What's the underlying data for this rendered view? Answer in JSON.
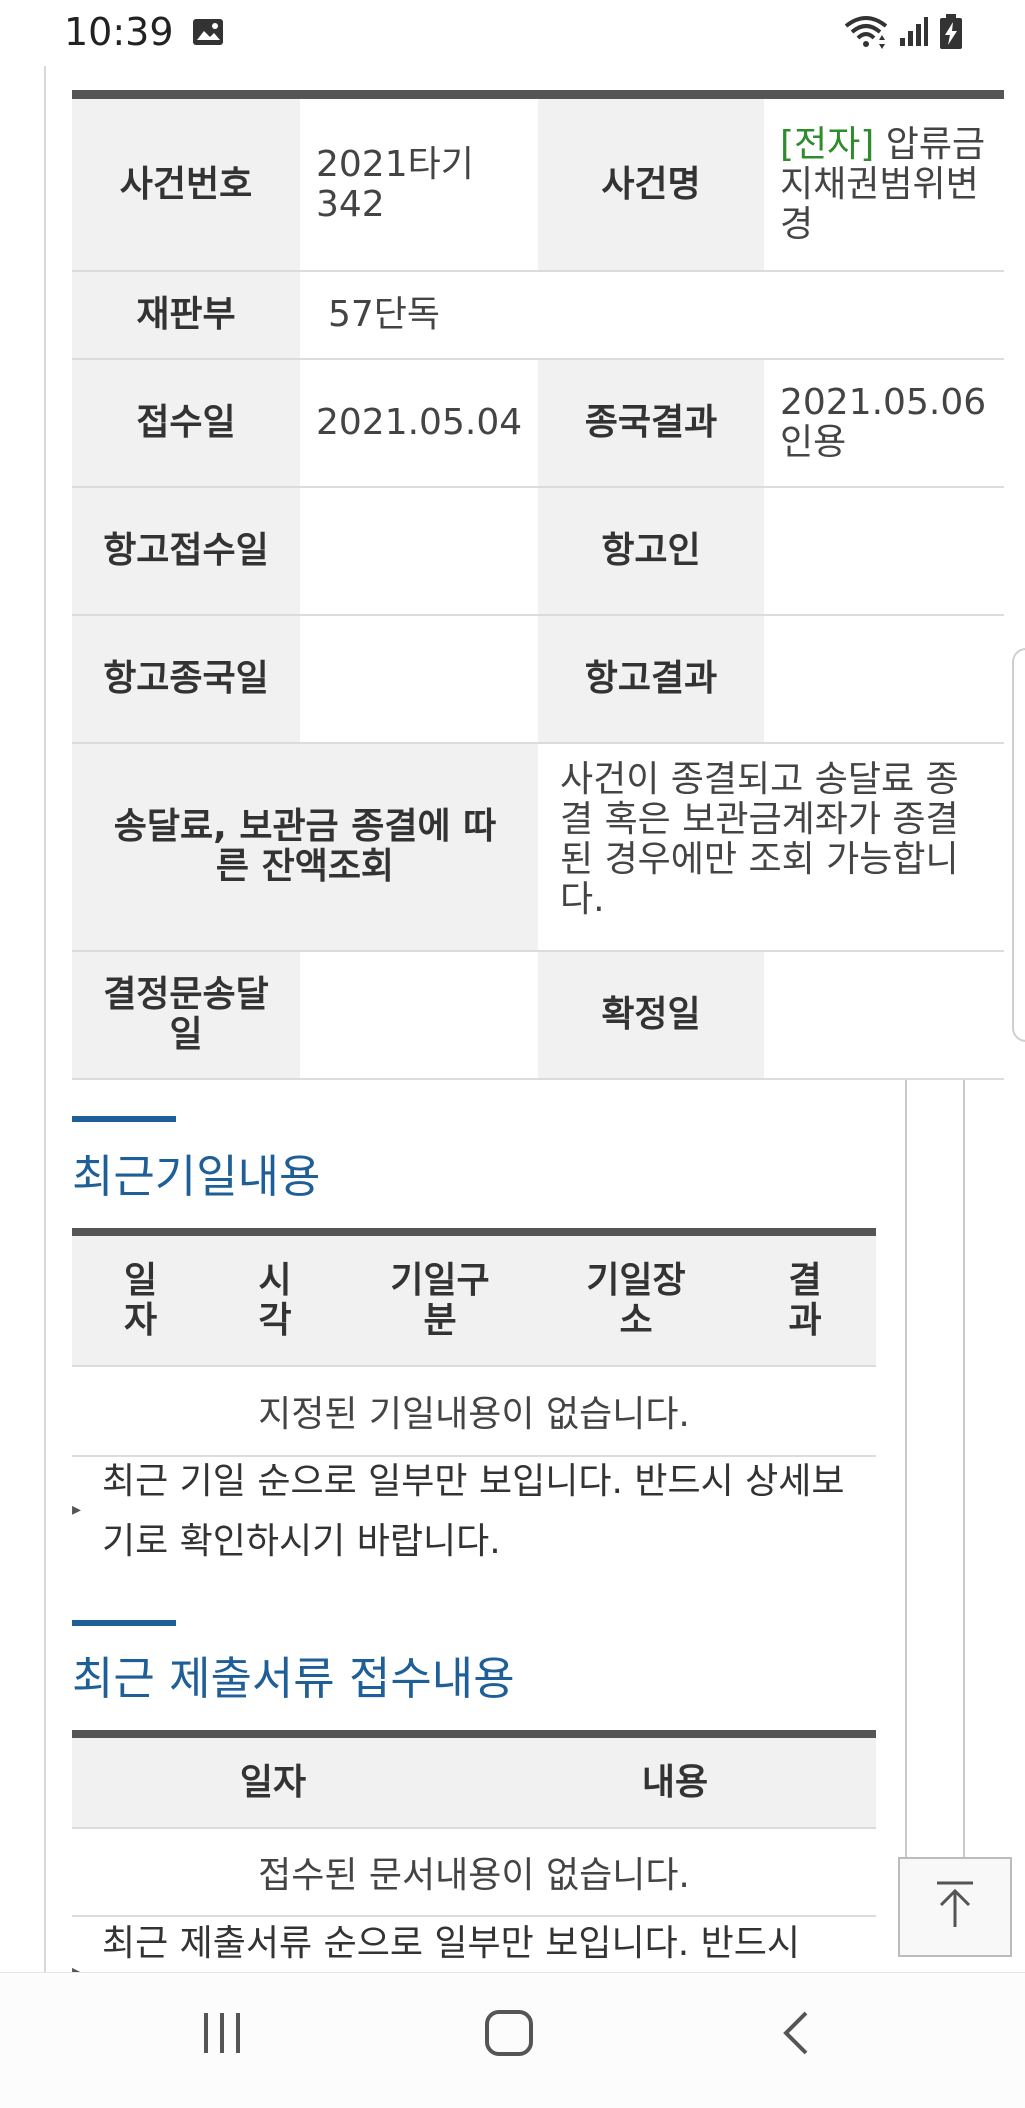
{
  "status_bar": {
    "time": "10:39"
  },
  "case_info": {
    "case_number_label": "사건번호",
    "case_number_value": "2021타기342",
    "case_name_label": "사건명",
    "case_name_tag": "[전자]",
    "case_name_value": " 압류금지채권범위변경",
    "court_division_label": "재판부",
    "court_division_value": "57단독",
    "receipt_date_label": "접수일",
    "receipt_date_value": "2021.05.04",
    "final_result_label": "종국결과",
    "final_result_value": "2021.05.06 인용",
    "appeal_receipt_label": "항고접수일",
    "appeal_receipt_value": "",
    "appellant_label": "항고인",
    "appellant_value": "",
    "appeal_final_label": "항고종국일",
    "appeal_final_value": "",
    "appeal_result_label": "항고결과",
    "appeal_result_value": "",
    "balance_inquiry_label": "송달료, 보관금 종결에 따른 잔액조회",
    "balance_inquiry_value": "사건이 종결되고 송달료 종결 혹은 보관금계좌가 종결된 경우에만 조회 가능합니다.",
    "decision_delivery_label": "결정문송달일",
    "decision_delivery_value": "",
    "confirmed_date_label": "확정일",
    "confirmed_date_value": ""
  },
  "recent_hearings": {
    "title": "최근기일내용",
    "columns": [
      "일자",
      "시각",
      "기일구분",
      "기일장소",
      "결과"
    ],
    "empty_message": "지정된 기일내용이 없습니다.",
    "note": "최근 기일 순으로 일부만 보입니다. 반드시 상세보기로 확인하시기 바랍니다."
  },
  "recent_documents": {
    "title": "최근 제출서류 접수내용",
    "columns": [
      "일자",
      "내용"
    ],
    "empty_message": "접수된 문서내용이 없습니다.",
    "note": "최근 제출서류 순으로 일부만 보입니다. 반드시"
  },
  "colors": {
    "section_title": "#1f5f97",
    "tag_green": "#2e8b2e",
    "header_bg": "#f1f1f1"
  },
  "icons": {
    "status_image": "image-icon",
    "wifi": "wifi-icon",
    "signal": "signal-icon",
    "battery": "battery-charging-icon",
    "scroll_top": "scroll-to-top-icon",
    "recents": "recent-apps-icon",
    "home": "home-icon",
    "back": "back-icon"
  }
}
